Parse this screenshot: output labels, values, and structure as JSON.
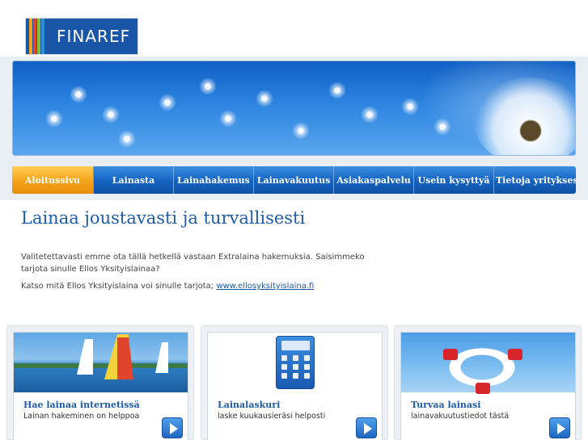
{
  "brand": {
    "logo_text": "FINAREF",
    "logo_stripe_colors": [
      "#f2a31b",
      "#e0452c",
      "#7fbf3a",
      "#2a8fd8"
    ]
  },
  "banner": {
    "image": "dandelion-sky"
  },
  "nav": {
    "items": [
      {
        "label": "Aloitussivu",
        "active": true
      },
      {
        "label": "Lainasta",
        "active": false
      },
      {
        "label": "Lainahakemus",
        "active": false
      },
      {
        "label": "Lainavakuutus",
        "active": false
      },
      {
        "label": "Asiakaspalvelu",
        "active": false
      },
      {
        "label": "Usein kysyttyä",
        "active": false
      },
      {
        "label": "Tietoja yrityksestä",
        "active": false
      }
    ]
  },
  "main": {
    "title": "Lainaa joustavasti ja turvallisesti",
    "notice_line1": "Valitetettavasti emme ota tällä hetkellä vastaan Extralaina hakemuksia. Saisimmeko tarjota sinulle Ellos Yksityislainaa?",
    "notice_line2_prefix": "Katso mitä Ellos Yksityislaina voi sinulle tarjota;",
    "notice_link": "www.ellosyksityislaina.fi"
  },
  "boxes": [
    {
      "title": "Hae lainaa internetissä",
      "subtitle": "Lainan hakeminen on helppoa",
      "image": "sailboats"
    },
    {
      "title": "Lainalaskuri",
      "subtitle": "laske kuukausieräsi helposti",
      "image": "calculator-icon"
    },
    {
      "title": "Turvaa lainasi",
      "subtitle": "lainavakuutustiedot tästä",
      "image": "life-buoy"
    }
  ],
  "colors": {
    "accent_blue": "#1d5ca8",
    "nav_active": "#f5a21a",
    "nav_blue": "#1462c0"
  }
}
